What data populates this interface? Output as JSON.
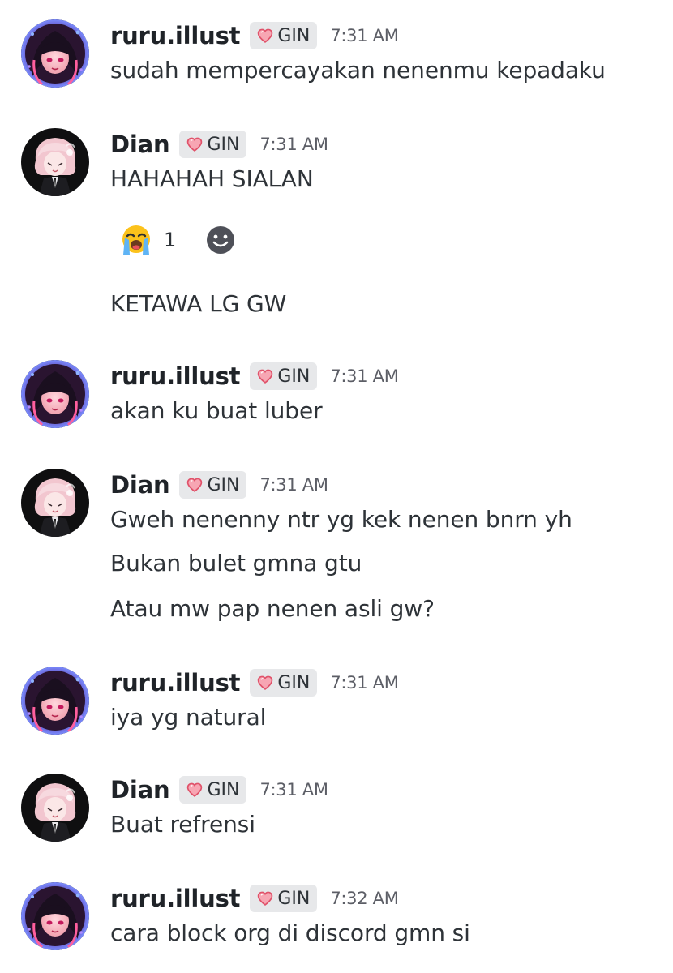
{
  "colors": {
    "username": "#1f2328",
    "body_text": "#2e3338",
    "timestamp": "#5c5e66",
    "tag_background": "#e7e8ea",
    "heart": "#f06e7e"
  },
  "tag_icon": "pink-heart-icon",
  "messages": [
    {
      "author": "ruru.illust",
      "avatar": "avatar-ruru",
      "tag": "GIN",
      "time": "7:31 AM",
      "lines": [
        "sudah mempercayakan nenenmu kepadaku"
      ]
    },
    {
      "author": "Dian",
      "avatar": "avatar-dian",
      "tag": "GIN",
      "time": "7:31 AM",
      "lines": [
        "HAHAHAH SIALAN"
      ],
      "reaction": {
        "emoji": "loudly-crying-face-emoji",
        "count": "1"
      },
      "add_reaction_icon": "smiley-add-reaction-icon",
      "followup": [
        "KETAWA LG GW"
      ]
    },
    {
      "author": "ruru.illust",
      "avatar": "avatar-ruru",
      "tag": "GIN",
      "time": "7:31 AM",
      "lines": [
        "akan ku buat luber"
      ]
    },
    {
      "author": "Dian",
      "avatar": "avatar-dian",
      "tag": "GIN",
      "time": "7:31 AM",
      "lines": [
        "Gweh nenenny ntr yg kek nenen bnrn yh",
        "Bukan bulet gmna gtu",
        "Atau mw pap nenen asli gw?"
      ]
    },
    {
      "author": "ruru.illust",
      "avatar": "avatar-ruru",
      "tag": "GIN",
      "time": "7:31 AM",
      "lines": [
        "iya yg natural"
      ]
    },
    {
      "author": "Dian",
      "avatar": "avatar-dian",
      "tag": "GIN",
      "time": "7:31 AM",
      "lines": [
        "Buat refrensi"
      ]
    },
    {
      "author": "ruru.illust",
      "avatar": "avatar-ruru",
      "tag": "GIN",
      "time": "7:32 AM",
      "lines": [
        "cara block org di discord gmn si"
      ]
    }
  ]
}
